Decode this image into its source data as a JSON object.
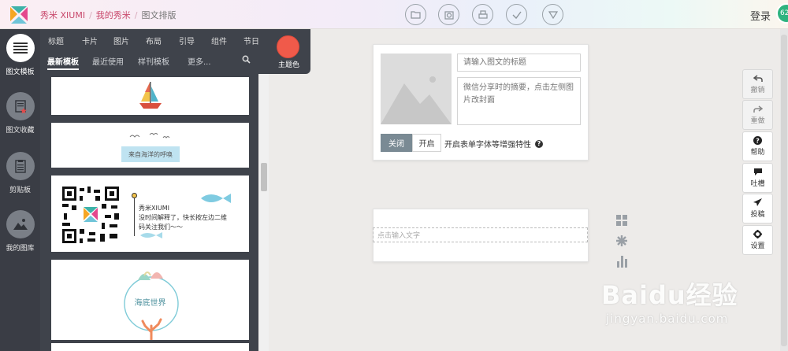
{
  "breadcrumb": [
    "秀米 XIUMI",
    "我的秀米",
    "图文排版"
  ],
  "toolbar_icons": [
    "folder-icon",
    "preview-icon",
    "print-icon",
    "check-icon",
    "dropdown-icon"
  ],
  "header": {
    "login": "登录",
    "avatar_badge": "62"
  },
  "leftnav": [
    {
      "label": "图文模板",
      "icon": "menu-lines-icon",
      "active": true
    },
    {
      "label": "图文收藏",
      "icon": "favorites-icon"
    },
    {
      "label": "剪贴板",
      "icon": "clipboard-icon"
    },
    {
      "label": "我的图库",
      "icon": "gallery-icon"
    }
  ],
  "categories": [
    "标题",
    "卡片",
    "图片",
    "布局",
    "引导",
    "组件",
    "节日"
  ],
  "subtabs": [
    "最新模板",
    "最近使用",
    "样刊模板",
    "更多..."
  ],
  "theme": {
    "label": "主题色",
    "color": "#f05a4a"
  },
  "templates": {
    "card2_text": "来自海洋的呼唤",
    "card3_title": "秀米XIUMI",
    "card3_line1": "没时间解释了，快长按左边二维",
    "card3_line2": "码关注我们～～",
    "card4_text": "海底世界"
  },
  "editor": {
    "title_placeholder": "请输入图文的标题",
    "summary_placeholder": "微信分享时的摘要，点击左侧图片改封面",
    "off_label": "关闭",
    "on_label": "开启",
    "enhance_label": "开启表单字体等增强特性",
    "text_placeholder": "点击输入文字"
  },
  "right_tools": [
    {
      "label": "撤销",
      "icon": "undo-icon",
      "disabled": true
    },
    {
      "label": "重做",
      "icon": "redo-icon",
      "disabled": true
    },
    {
      "label": "帮助",
      "icon": "help-icon"
    },
    {
      "label": "吐槽",
      "icon": "comment-icon"
    },
    {
      "label": "投稿",
      "icon": "send-icon"
    },
    {
      "label": "设置",
      "icon": "settings-icon"
    }
  ],
  "watermark": {
    "main": "Baidu经验",
    "sub": "jingyan.baidu.com"
  }
}
